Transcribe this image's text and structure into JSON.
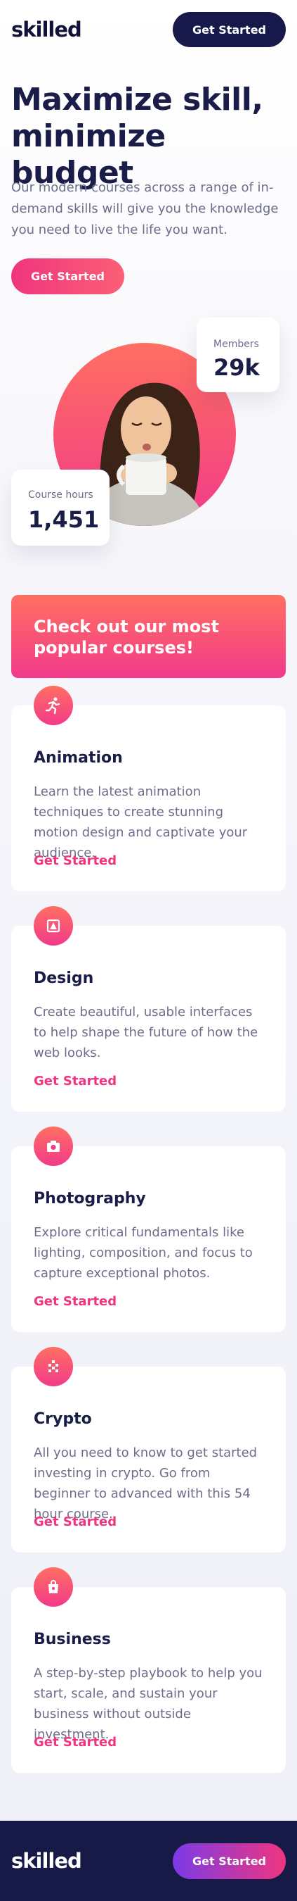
{
  "header": {
    "logo": "skilled",
    "cta_label": "Get Started"
  },
  "hero": {
    "title": "Maximize skill, minimize budget",
    "text": "Our modern courses across a range of in-demand skills will give you the knowledge you need to live the life you want.",
    "cta_label": "Get Started"
  },
  "stats": {
    "members": {
      "label": "Members",
      "value": "29k"
    },
    "hours": {
      "label": "Course hours",
      "value": "1,451"
    }
  },
  "banner": {
    "text": "Check out our most popular courses!"
  },
  "courses": [
    {
      "icon": "running-icon",
      "title": "Animation",
      "desc": "Learn the latest animation techniques to create stunning motion design and captivate your audience.",
      "link": "Get Started"
    },
    {
      "icon": "design-icon",
      "title": "Design",
      "desc": "Create beautiful, usable interfaces to help shape the future of how the web looks.",
      "link": "Get Started"
    },
    {
      "icon": "camera-icon",
      "title": "Photography",
      "desc": "Explore critical fundamentals like lighting, composition, and focus to capture exceptional photos.",
      "link": "Get Started"
    },
    {
      "icon": "crypto-icon",
      "title": "Crypto",
      "desc": "All you need to know to get started investing in crypto. Go from beginner to advanced with this 54 hour course.",
      "link": "Get Started"
    },
    {
      "icon": "briefcase-icon",
      "title": "Business",
      "desc": "A step-by-step playbook to help you start, scale, and sustain your business without outside investment.",
      "link": "Get Started"
    }
  ],
  "footer": {
    "logo": "skilled",
    "cta_label": "Get Started"
  },
  "colors": {
    "navy": "#17194a",
    "pink": "#f0357f",
    "coral": "#ff6f61",
    "purple": "#7a3be6",
    "gray_text": "#6c6e8a"
  }
}
